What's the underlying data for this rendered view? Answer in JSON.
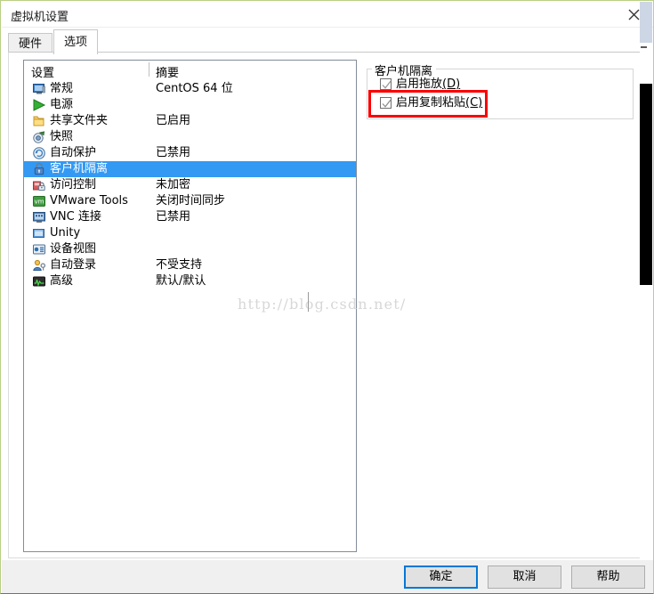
{
  "window": {
    "title": "虚拟机设置",
    "close_icon": "close-icon"
  },
  "tabs": [
    {
      "label": "硬件",
      "active": false
    },
    {
      "label": "选项",
      "active": true
    }
  ],
  "settings_list": {
    "headers": {
      "name": "设置",
      "summary": "摘要"
    },
    "rows": [
      {
        "icon": "monitor-icon",
        "label": "常规",
        "summary": "CentOS 64 位",
        "selected": false
      },
      {
        "icon": "power-icon",
        "label": "电源",
        "summary": "",
        "selected": false
      },
      {
        "icon": "folder-icon",
        "label": "共享文件夹",
        "summary": "已启用",
        "selected": false
      },
      {
        "icon": "camera-icon",
        "label": "快照",
        "summary": "",
        "selected": false
      },
      {
        "icon": "autoprotect-icon",
        "label": "自动保护",
        "summary": "已禁用",
        "selected": false
      },
      {
        "icon": "lock-icon",
        "label": "客户机隔离",
        "summary": "",
        "selected": true
      },
      {
        "icon": "access-lock-icon",
        "label": "访问控制",
        "summary": "未加密",
        "selected": false
      },
      {
        "icon": "vmware-tools-icon",
        "label": "VMware Tools",
        "summary": "关闭时间同步",
        "selected": false
      },
      {
        "icon": "vnc-icon",
        "label": "VNC 连接",
        "summary": "已禁用",
        "selected": false
      },
      {
        "icon": "unity-icon",
        "label": "Unity",
        "summary": "",
        "selected": false
      },
      {
        "icon": "deviceview-icon",
        "label": "设备视图",
        "summary": "",
        "selected": false
      },
      {
        "icon": "autologon-icon",
        "label": "自动登录",
        "summary": "不受支持",
        "selected": false
      },
      {
        "icon": "advanced-icon",
        "label": "高级",
        "summary": "默认/默认",
        "selected": false
      }
    ]
  },
  "right_pane": {
    "group_title": "客户机隔离",
    "checkboxes": [
      {
        "label": "启用拖放",
        "accel": "(D)",
        "checked": true,
        "highlighted": false
      },
      {
        "label": "启用复制粘贴",
        "accel": "(C)",
        "checked": true,
        "highlighted": true
      }
    ]
  },
  "watermark": {
    "text": "http://blog.csdn.net/"
  },
  "footer": {
    "ok_label": "确定",
    "cancel_label": "取消",
    "help_label": "帮助"
  },
  "colors": {
    "selection_blue": "#3399f3",
    "highlight_red": "#fb0000",
    "focus_blue": "#0078d7",
    "window_border": "#b9cf86"
  }
}
